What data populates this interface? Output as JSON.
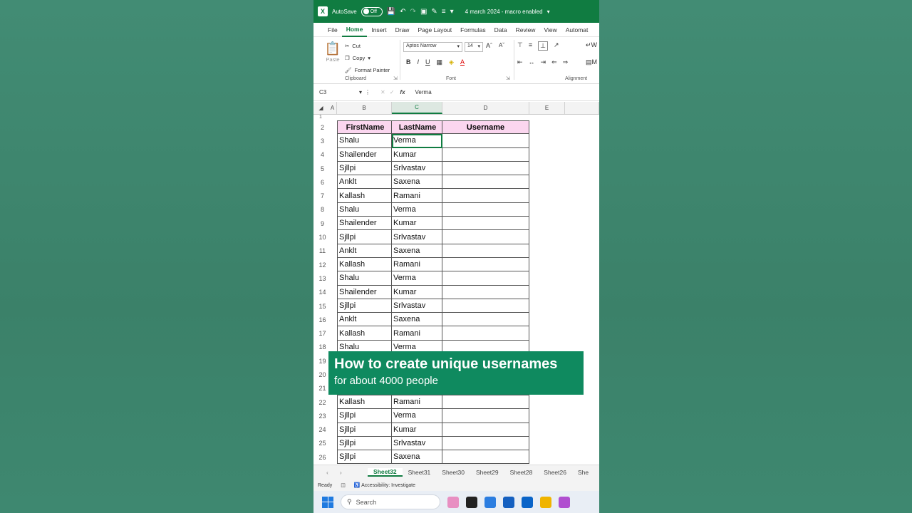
{
  "titlebar": {
    "autosave_label": "AutoSave",
    "toggle_state": "Off",
    "doc_title": "4 march 2024 - macro enabled"
  },
  "menu": [
    "File",
    "Home",
    "Insert",
    "Draw",
    "Page Layout",
    "Formulas",
    "Data",
    "Review",
    "View",
    "Automat"
  ],
  "ribbon": {
    "paste": "Paste",
    "cut": "Cut",
    "copy": "Copy",
    "format_painter": "Format Painter",
    "clipboard_label": "Clipboard",
    "font_name": "Aptos Narrow",
    "font_size": "14",
    "font_label": "Font",
    "alignment_label": "Alignment"
  },
  "formula_bar": {
    "name_box": "C3",
    "fx": "fx",
    "value": "Verma"
  },
  "columns": [
    "A",
    "B",
    "C",
    "D",
    "E"
  ],
  "table": {
    "headers": [
      "FirstName",
      "LastName",
      "Username"
    ],
    "rows": [
      {
        "n": "3",
        "first": "Shalu",
        "last": "Verma"
      },
      {
        "n": "4",
        "first": "Shailender",
        "last": "Kumar"
      },
      {
        "n": "5",
        "first": "Sjllpi",
        "last": "Srlvastav"
      },
      {
        "n": "6",
        "first": "Anklt",
        "last": "Saxena"
      },
      {
        "n": "7",
        "first": "Kallash",
        "last": "Ramani"
      },
      {
        "n": "8",
        "first": "Shalu",
        "last": "Verma"
      },
      {
        "n": "9",
        "first": "Shailender",
        "last": "Kumar"
      },
      {
        "n": "10",
        "first": "Sjllpi",
        "last": "Srlvastav"
      },
      {
        "n": "11",
        "first": "Anklt",
        "last": "Saxena"
      },
      {
        "n": "12",
        "first": "Kallash",
        "last": "Ramani"
      },
      {
        "n": "13",
        "first": "Shalu",
        "last": "Verma"
      },
      {
        "n": "14",
        "first": "Shailender",
        "last": "Kumar"
      },
      {
        "n": "15",
        "first": "Sjllpi",
        "last": "Srlvastav"
      },
      {
        "n": "16",
        "first": "Anklt",
        "last": "Saxena"
      },
      {
        "n": "17",
        "first": "Kallash",
        "last": "Ramani"
      },
      {
        "n": "18",
        "first": "Shalu",
        "last": "Verma"
      },
      {
        "n": "19",
        "first": "",
        "last": ""
      },
      {
        "n": "20",
        "first": "",
        "last": ""
      },
      {
        "n": "21",
        "first": "",
        "last": ""
      },
      {
        "n": "22",
        "first": "Kallash",
        "last": "Ramani"
      },
      {
        "n": "23",
        "first": "Sjllpi",
        "last": "Verma"
      },
      {
        "n": "24",
        "first": "Sjllpi",
        "last": "Kumar"
      },
      {
        "n": "25",
        "first": "Sjllpi",
        "last": "Srlvastav"
      },
      {
        "n": "26",
        "first": "Sjllpi",
        "last": "Saxena"
      }
    ]
  },
  "banner": {
    "title": "How to create unique usernames",
    "subtitle": "for about 4000 people"
  },
  "sheet_tabs": [
    "Sheet32",
    "Sheet31",
    "Sheet30",
    "Sheet29",
    "Sheet28",
    "Sheet26",
    "She"
  ],
  "status": {
    "ready": "Ready",
    "accessibility": "Accessibility: Investigate"
  },
  "taskbar": {
    "search": "Search"
  }
}
